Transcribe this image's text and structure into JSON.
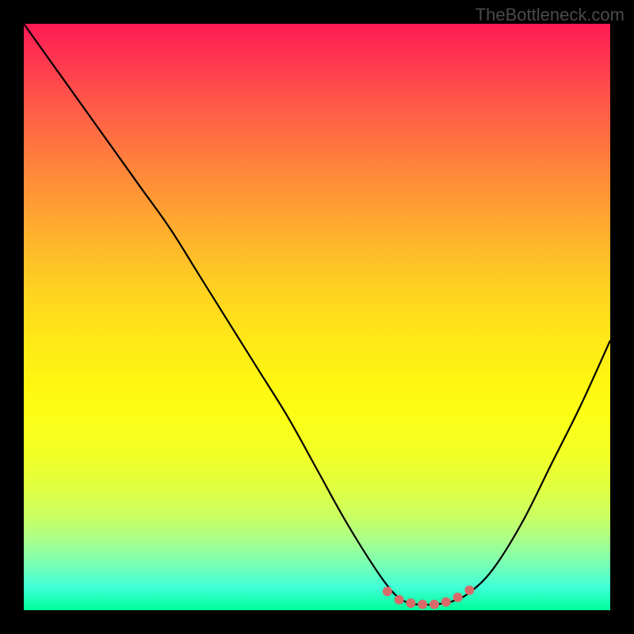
{
  "watermark": "TheBottleneck.com",
  "chart_data": {
    "type": "line",
    "title": "",
    "xlabel": "",
    "ylabel": "",
    "xlim": [
      0,
      100
    ],
    "ylim": [
      0,
      100
    ],
    "x": [
      0,
      5,
      10,
      15,
      20,
      25,
      30,
      35,
      40,
      45,
      50,
      55,
      60,
      63,
      65,
      67,
      70,
      73,
      76,
      80,
      85,
      90,
      95,
      100
    ],
    "y": [
      100,
      93,
      86,
      79,
      72,
      65,
      57,
      49,
      41,
      33,
      24,
      15,
      7,
      3,
      1.5,
      1,
      1,
      1.5,
      3,
      7,
      15,
      25,
      35,
      46
    ],
    "markers_x": [
      62,
      64,
      66,
      68,
      70,
      72,
      74,
      76
    ],
    "markers_y": [
      3.2,
      1.8,
      1.2,
      1,
      1,
      1.4,
      2.2,
      3.4
    ],
    "note": "Smooth V-shaped curve with minimum near x≈69; red dotted markers along the valley floor; rainbow vertical gradient background from red (top) through yellow to green (bottom)."
  }
}
